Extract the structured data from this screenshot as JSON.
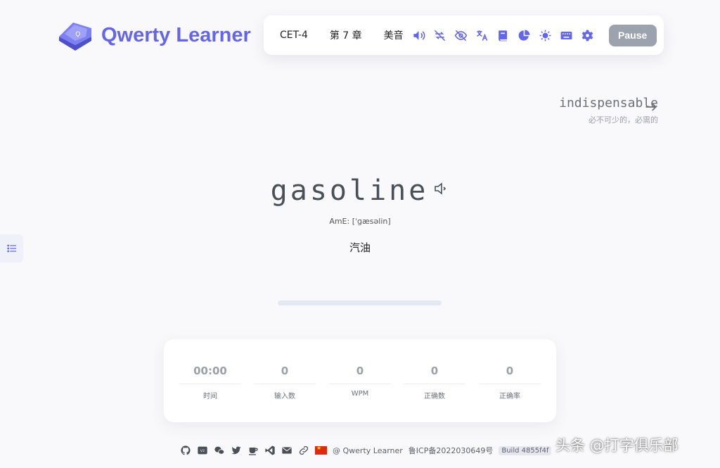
{
  "app": {
    "title": "Qwerty Learner"
  },
  "toolbar": {
    "dict": "CET-4",
    "chapter": "第 7 章",
    "pronunciation": "美音",
    "pause_label": "Pause",
    "icons": [
      "speaker-icon",
      "loop-off-icon",
      "eye-off-icon",
      "translate-icon",
      "book-icon",
      "pie-chart-icon",
      "sun-icon",
      "keyboard-icon",
      "gear-icon"
    ]
  },
  "next_word": {
    "word": "indispensable",
    "translation": "必不可少的，必需的"
  },
  "current": {
    "word": "gasoline",
    "phonetic": "AmE: [ˈɡæsəlin]",
    "translation": "汽油",
    "progress": 0
  },
  "stats": [
    {
      "value": "00:00",
      "label": "时间"
    },
    {
      "value": "0",
      "label": "输入数"
    },
    {
      "value": "0",
      "label": "WPM"
    },
    {
      "value": "0",
      "label": "正确数"
    },
    {
      "value": "0",
      "label": "正确率"
    }
  ],
  "footer": {
    "credit": "@ Qwerty Learner",
    "icp": "鲁ICP备2022030649号",
    "build": "Build 4855f4f"
  },
  "watermark": "头条 @打字俱乐部",
  "colors": {
    "accent": "#6466e9",
    "pause_bg": "#9ca3af",
    "background": "#f9f9fb"
  }
}
